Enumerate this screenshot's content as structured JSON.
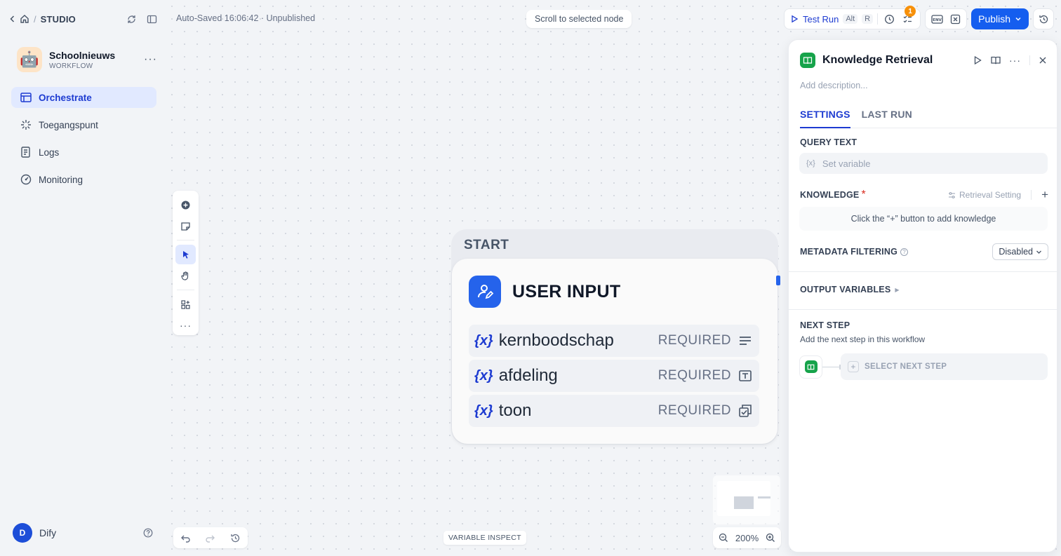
{
  "sidebar": {
    "breadcrumb": {
      "section": "STUDIO"
    },
    "app": {
      "name": "Schoolnieuws",
      "type": "WORKFLOW",
      "avatar_emoji": "🤖"
    },
    "nav": [
      {
        "label": "Orchestrate",
        "icon": "orchestrate-icon",
        "active": true
      },
      {
        "label": "Toegangspunt",
        "icon": "access-point-icon",
        "active": false
      },
      {
        "label": "Logs",
        "icon": "logs-icon",
        "active": false
      },
      {
        "label": "Monitoring",
        "icon": "monitoring-icon",
        "active": false
      }
    ],
    "user": {
      "initial": "D",
      "name": "Dify"
    }
  },
  "header": {
    "autosave": "Auto-Saved 16:06:42 · Unpublished",
    "scroll_hint": "Scroll to selected node",
    "test_run": {
      "label": "Test Run",
      "key1": "Alt",
      "key2": "R"
    },
    "checklist_badge": "1",
    "publish_label": "Publish"
  },
  "canvas": {
    "node": {
      "group_title": "START",
      "title": "USER INPUT",
      "variables": [
        {
          "name": "kernboodschap",
          "required": "REQUIRED",
          "type_icon": "paragraph-icon"
        },
        {
          "name": "afdeling",
          "required": "REQUIRED",
          "type_icon": "text-input-icon"
        },
        {
          "name": "toon",
          "required": "REQUIRED",
          "type_icon": "select-icon"
        }
      ],
      "var_symbol": "{x}"
    },
    "zoom": "200%",
    "variable_inspect": "VARIABLE INSPECT"
  },
  "panel": {
    "title": "Knowledge Retrieval",
    "description_placeholder": "Add description...",
    "tabs": [
      {
        "label": "SETTINGS",
        "active": true
      },
      {
        "label": "LAST RUN",
        "active": false
      }
    ],
    "query_text": {
      "label": "QUERY TEXT",
      "placeholder": "Set variable",
      "var_symbol": "{x}"
    },
    "knowledge": {
      "label": "KNOWLEDGE",
      "required_mark": "*",
      "retrieval_setting": "Retrieval Setting",
      "add": "+",
      "empty": "Click the “+” button to add knowledge"
    },
    "metadata": {
      "label": "METADATA FILTERING",
      "value": "Disabled"
    },
    "output_variables": {
      "label": "OUTPUT VARIABLES"
    },
    "next_step": {
      "label": "NEXT STEP",
      "description": "Add the next step in this workflow",
      "select_label": "SELECT NEXT STEP"
    }
  },
  "colors": {
    "accent": "#155eef",
    "brand_blue": "#1d3bd1",
    "knowledge_green": "#16a34a",
    "badge_orange": "#f79009"
  }
}
